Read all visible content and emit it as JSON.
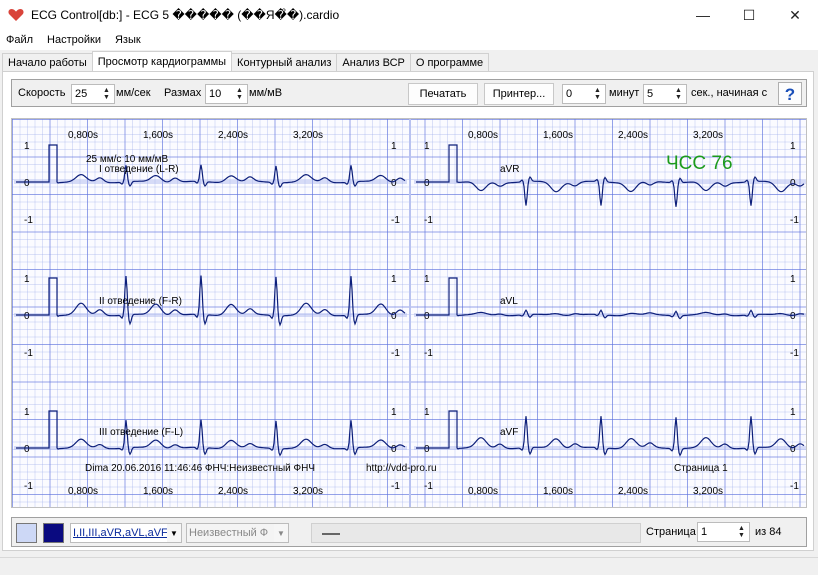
{
  "window": {
    "title": "ECG Control[db:] - ECG 5 ����� (��Я�̊�).cardio",
    "minimize": "—",
    "maximize": "☐",
    "close": "✕"
  },
  "menu": [
    "Файл",
    "Настройки",
    "Язык"
  ],
  "tabs": [
    "Начало работы",
    "Просмотр кардиограммы",
    "Контурный анализ",
    "Анализ ВСР",
    "О программе"
  ],
  "toolbar": {
    "speed_label": "Скорость",
    "speed_value": "25",
    "speed_unit": "мм/сек",
    "amp_label": "Размах",
    "amp_value": "10",
    "amp_unit": "мм/мВ",
    "print_button": "Печатать",
    "printer_button": "Принтер...",
    "minutes_value": "0",
    "minutes_label": "минут",
    "seconds_value": "5",
    "seconds_label": "сек., начиная с",
    "help_label": "?"
  },
  "ecg": {
    "time_ticks": [
      "0,800s",
      "1,600s",
      "2,400s",
      "3,200s"
    ],
    "scale_info": "25 мм/с  10 мм/мВ",
    "y_ticks": [
      "1",
      "0",
      "-1"
    ],
    "leads": [
      {
        "name": "I отведение (L-R)"
      },
      {
        "name": "aVR"
      },
      {
        "name": "II отведение (F-R)"
      },
      {
        "name": "aVL"
      },
      {
        "name": "III отведение (F-L)"
      },
      {
        "name": "aVF"
      }
    ],
    "heart_rate": "ЧСС 76",
    "patient_info": "Dima 20.06.2016 11:46:46 ФНЧ:Неизвестный ФНЧ",
    "url": "http://vdd-pro.ru",
    "page_info": "Страница 1",
    "trace_color": "#0d1f7a",
    "baseline_color": "#a8b4ee",
    "grid_color": "#5a6edc"
  },
  "bottom": {
    "leads_select": "I,II,III,aVR,aVL,aVF",
    "filter_select": "Неизвестный Ф",
    "page_label": "Страница",
    "page_value": "1",
    "page_total": "из 84",
    "swatch_bg": "#cdd8f6",
    "swatch_fg": "#0a0a80"
  }
}
